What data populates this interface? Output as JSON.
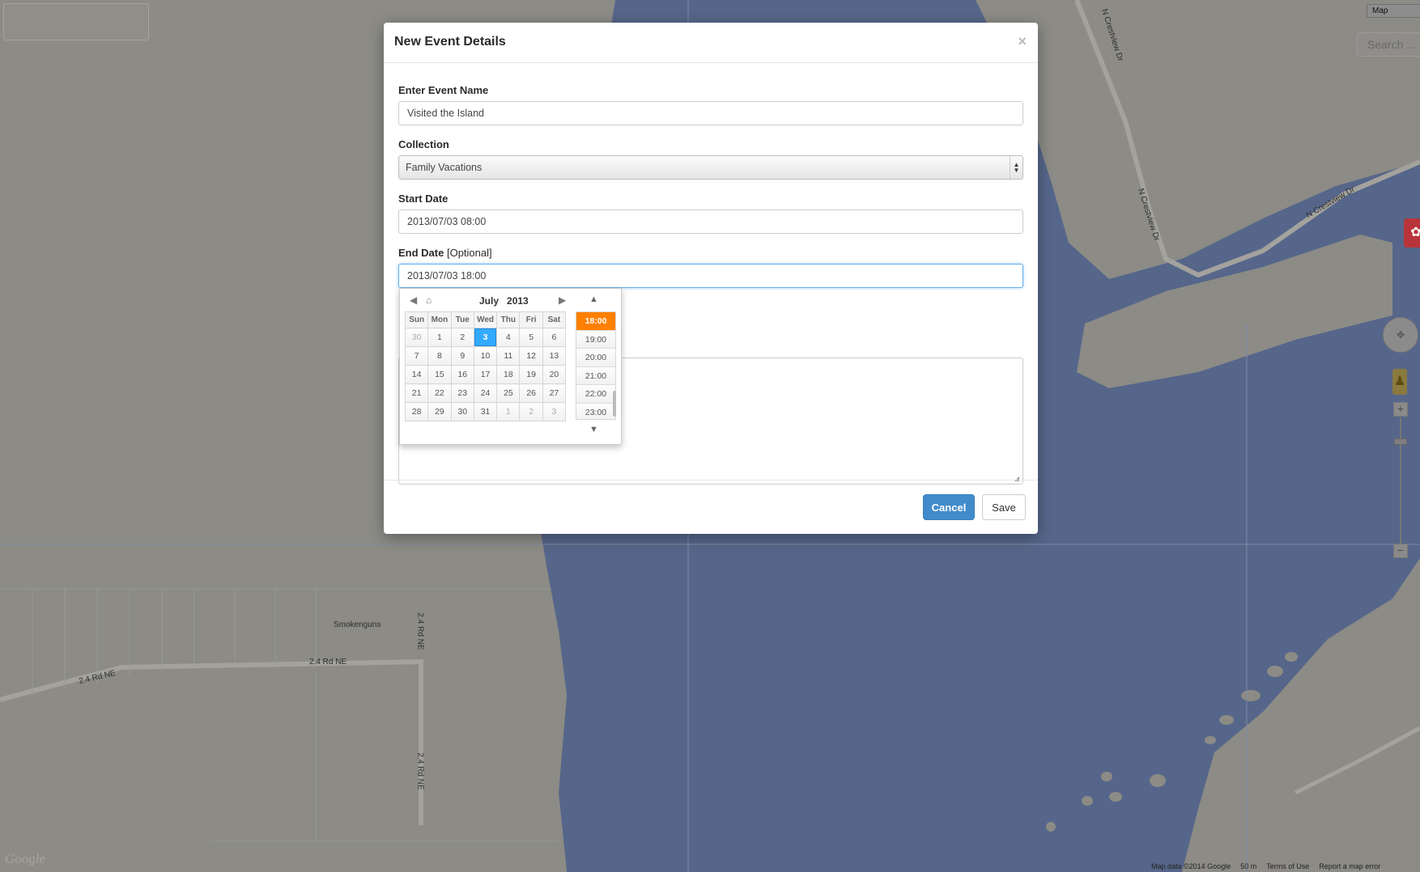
{
  "map": {
    "type_label": "Map",
    "search_placeholder": "Search ...",
    "labels": {
      "crestview_dr_1": "N Crestview Dr",
      "crestview_dr_2": "N Crestview Dr",
      "crestview_dr_3": "N Crestview Dr",
      "smokenguns": "Smokenguns",
      "rd_ne_1": "2.4 Rd NE",
      "rd_ne_2": "2.4 Rd NE",
      "rd_ne_3": "2.4 Rd NE",
      "rd_ne_4": "2.4 Rd NE"
    },
    "footer": {
      "map_data": "Map data ©2014 Google",
      "scale": "50 m",
      "terms": "Terms of Use",
      "report": "Report a map error"
    },
    "logo": "Google",
    "colors": {
      "land": "#8c8b86",
      "water": "#56668a"
    }
  },
  "modal": {
    "title": "New Event Details",
    "close_symbol": "×",
    "fields": {
      "event_name": {
        "label": "Enter Event Name",
        "value": "Visited the Island"
      },
      "collection": {
        "label": "Collection",
        "value": "Family Vacations"
      },
      "start_date": {
        "label": "Start Date",
        "value": "2013/07/03 08:00"
      },
      "end_date": {
        "label": "End Date",
        "optional": "[Optional]",
        "value": "2013/07/03 18:00"
      }
    },
    "buttons": {
      "cancel": "Cancel",
      "save": "Save"
    }
  },
  "datepicker": {
    "month": "July",
    "year": "2013",
    "weekdays": [
      "Sun",
      "Mon",
      "Tue",
      "Wed",
      "Thu",
      "Fri",
      "Sat"
    ],
    "weeks": [
      [
        "30",
        "1",
        "2",
        "3",
        "4",
        "5",
        "6"
      ],
      [
        "7",
        "8",
        "9",
        "10",
        "11",
        "12",
        "13"
      ],
      [
        "14",
        "15",
        "16",
        "17",
        "18",
        "19",
        "20"
      ],
      [
        "21",
        "22",
        "23",
        "24",
        "25",
        "26",
        "27"
      ],
      [
        "28",
        "29",
        "30",
        "31",
        "1",
        "2",
        "3"
      ]
    ],
    "selected_day": "3",
    "times": [
      "18:00",
      "19:00",
      "20:00",
      "21:00",
      "22:00",
      "23:00"
    ],
    "selected_time": "18:00",
    "colors": {
      "selected_day": "#33aaff",
      "selected_time": "#ff8000"
    }
  }
}
